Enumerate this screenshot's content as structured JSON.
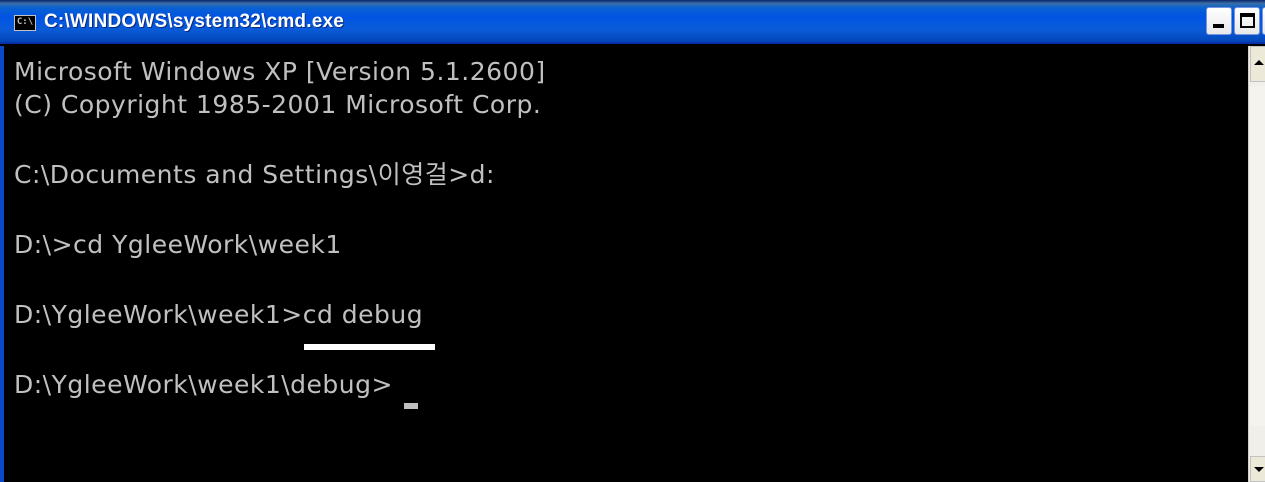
{
  "window": {
    "title": "C:\\WINDOWS\\system32\\cmd.exe",
    "icon_text": "C:\\"
  },
  "console": {
    "lines": [
      "Microsoft Windows XP [Version 5.1.2600]",
      "(C) Copyright 1985-2001 Microsoft Corp.",
      "C:\\Documents and Settings\\이영걸>d:",
      "D:\\>cd YgleeWork\\week1",
      "D:\\YgleeWork\\week1>cd debug",
      "D:\\YgleeWork\\week1\\debug>"
    ]
  },
  "titlebar_buttons": {
    "minimize": "minimize-button",
    "maximize": "maximize-button",
    "close": "close-button"
  },
  "colors": {
    "console_bg": "#000000",
    "console_text": "#c0c0c0",
    "title_bar": "#0054e3",
    "highlight_mark": "#ffffff"
  }
}
